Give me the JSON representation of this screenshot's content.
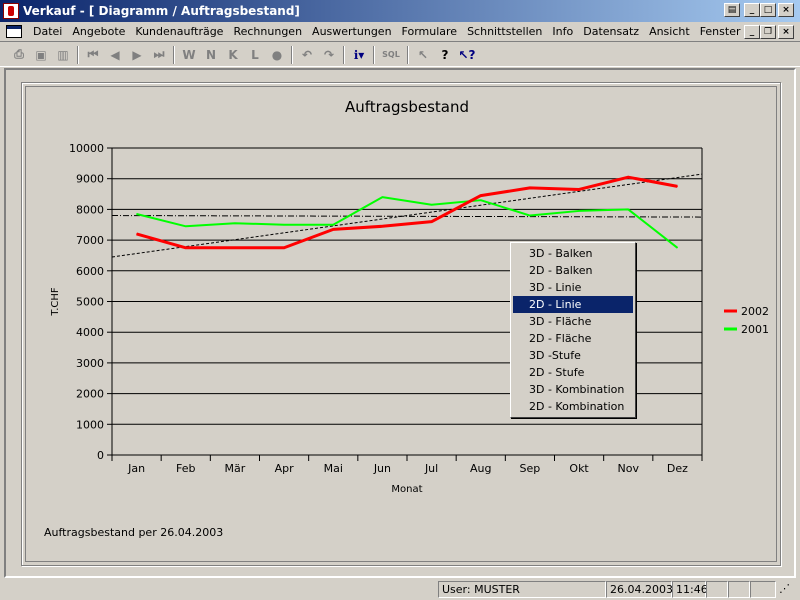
{
  "window": {
    "title": "Verkauf - [ Diagramm / Auftragsbestand]"
  },
  "menu": {
    "items": [
      "Datei",
      "Angebote",
      "Kundenaufträge",
      "Rechnungen",
      "Auswertungen",
      "Formulare",
      "Schnittstellen",
      "Info",
      "Datensatz",
      "Ansicht",
      "Fenster",
      "?"
    ]
  },
  "toolbar": {
    "buttons": [
      "printer-icon",
      "preview-icon",
      "chart-icon",
      "first-record-icon",
      "prev-record-icon",
      "next-record-icon",
      "last-record-icon",
      "W",
      "N",
      "K",
      "L",
      "record-dot-icon",
      "undo-icon",
      "redo-icon",
      "info-icon",
      "SQL",
      "pointer-icon",
      "help-icon",
      "context-help-icon"
    ]
  },
  "chart_data": {
    "type": "line",
    "title": "Auftragsbestand",
    "xlabel": "Monat",
    "ylabel": "T.CHF",
    "ylim": [
      0,
      10000
    ],
    "yticks": [
      0,
      1000,
      2000,
      3000,
      4000,
      5000,
      6000,
      7000,
      8000,
      9000,
      10000
    ],
    "categories": [
      "Jan",
      "Feb",
      "Mär",
      "Apr",
      "Mai",
      "Jun",
      "Jul",
      "Aug",
      "Sep",
      "Okt",
      "Nov",
      "Dez"
    ],
    "grid": "horizontal",
    "legend_position": "right",
    "series": [
      {
        "name": "2002",
        "color": "#ff0000",
        "values": [
          7200,
          6750,
          6750,
          6750,
          7350,
          7450,
          7600,
          8450,
          8700,
          8650,
          9050,
          8750
        ]
      },
      {
        "name": "2001",
        "color": "#00ff00",
        "values": [
          7850,
          7450,
          7550,
          7500,
          7500,
          8400,
          8150,
          8300,
          7800,
          7950,
          8000,
          6750
        ]
      }
    ],
    "trendlines": [
      {
        "style": "dash-dot",
        "color": "#000000",
        "start": 7800,
        "end": 7750
      },
      {
        "style": "dashed",
        "color": "#000000",
        "start": 6450,
        "end": 9150
      }
    ]
  },
  "footnote": "Auftragsbestand per 26.04.2003",
  "context_menu": {
    "items": [
      "3D - Balken",
      "2D - Balken",
      "3D - Linie",
      "2D - Linie",
      "3D - Fläche",
      "2D - Fläche",
      "3D -Stufe",
      "2D - Stufe",
      "3D - Kombination",
      "2D - Kombination"
    ],
    "selected_index": 3
  },
  "status": {
    "user": "User: MUSTER",
    "date": "26.04.2003",
    "time": "11:46"
  }
}
